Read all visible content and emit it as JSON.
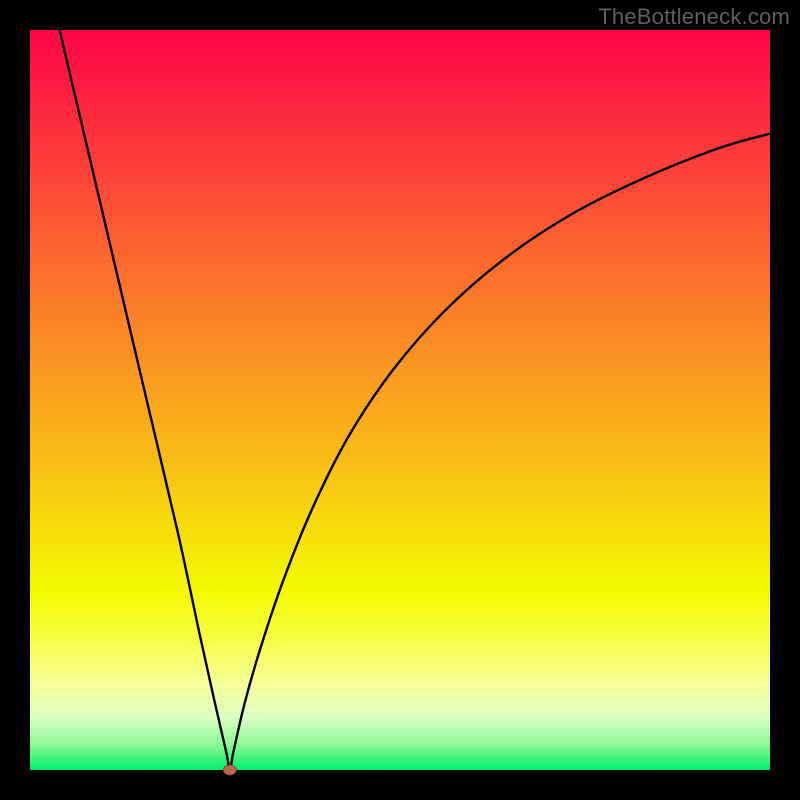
{
  "watermark": "TheBottleneck.com",
  "chart_data": {
    "type": "line",
    "title": "",
    "xlabel": "",
    "ylabel": "",
    "xlim": [
      0,
      100
    ],
    "ylim": [
      0,
      100
    ],
    "notes": "Top-right watermark. Gradient background from red (top) through orange/yellow to green (bottom). A single black curve descends from top-left, reaches a minimum near x≈27 at the baseline (small brown dot), then rises concavely toward the upper-right. Axis labels and tick labels are not shown.",
    "series": [
      {
        "name": "bottleneck-curve",
        "x": [
          4,
          8,
          12,
          16,
          20,
          23,
          25,
          26.5,
          27,
          27.5,
          29,
          31,
          34,
          38,
          43,
          49,
          56,
          64,
          73,
          83,
          93,
          100
        ],
        "y": [
          100,
          83,
          66,
          49,
          32,
          18,
          9,
          2.5,
          0,
          2.5,
          9,
          16,
          25,
          35,
          45,
          54,
          62,
          69,
          75,
          80,
          84,
          86
        ]
      }
    ],
    "marker": {
      "x": 27,
      "y": 0
    },
    "gradient_stops": [
      {
        "offset": 0.0,
        "color": "#fd0548"
      },
      {
        "offset": 0.2,
        "color": "#fd4538"
      },
      {
        "offset": 0.4,
        "color": "#fb8526"
      },
      {
        "offset": 0.6,
        "color": "#f8c313"
      },
      {
        "offset": 0.76,
        "color": "#f4fa01"
      },
      {
        "offset": 0.82,
        "color": "#f6fe40"
      },
      {
        "offset": 0.88,
        "color": "#f9ff94"
      },
      {
        "offset": 0.93,
        "color": "#dbffc4"
      },
      {
        "offset": 0.965,
        "color": "#8df997"
      },
      {
        "offset": 1.0,
        "color": "#02ef6b"
      }
    ],
    "frame": {
      "border_px": 30,
      "border_color": "#000000"
    }
  }
}
